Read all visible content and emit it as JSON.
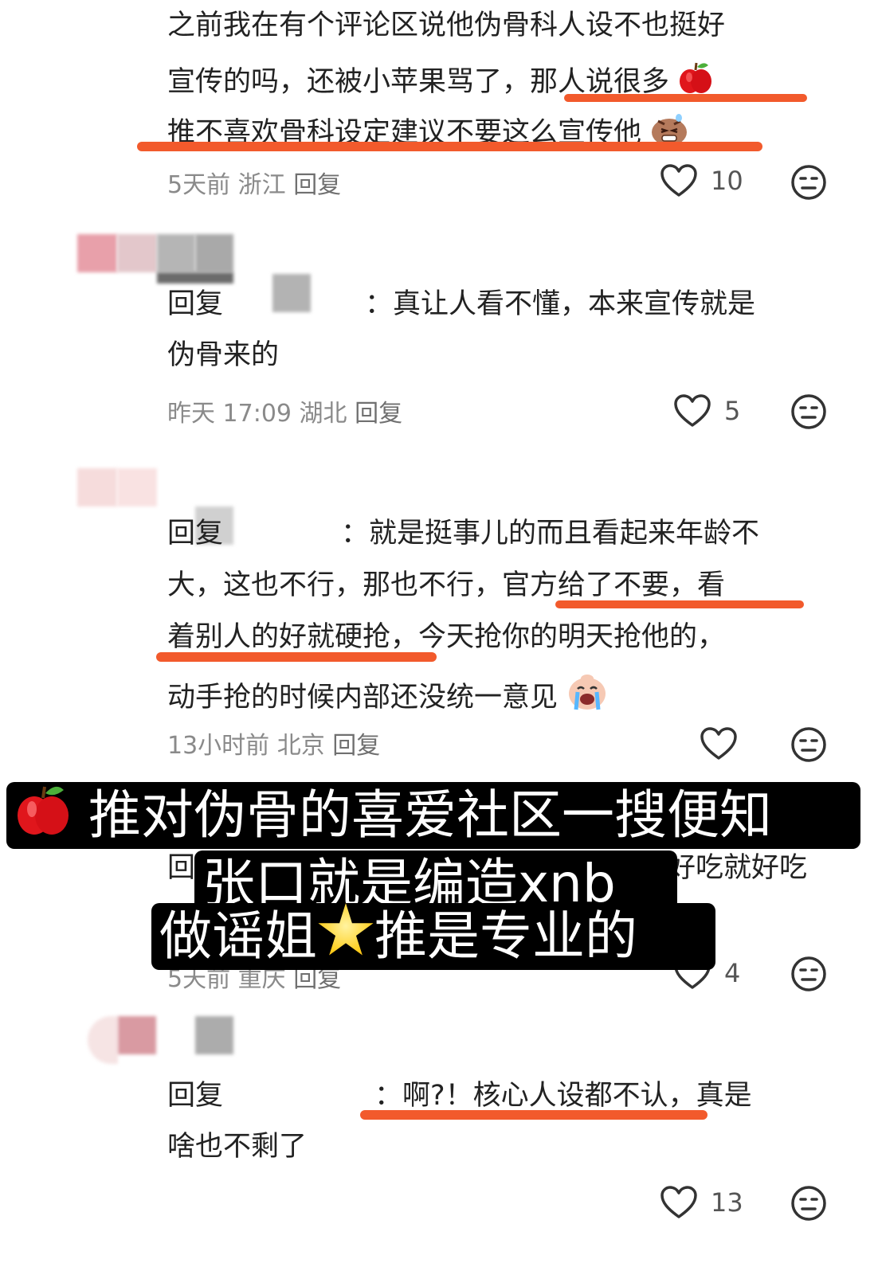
{
  "comments": [
    {
      "lines": [
        "之前我在有个评论区说他伪骨科人设不也挺好",
        "宣传的吗，还被小苹果骂了，那人说很多",
        "推不喜欢骨科设定建议不要这么宣传他"
      ],
      "time": "5天前",
      "location": "浙江",
      "reply_label": "回复",
      "likes": "10"
    },
    {
      "lines": [
        "回复",
        "：真让人看不懂，本来宣传就是",
        "伪骨来的"
      ],
      "time": "昨天 17:09",
      "location": "湖北",
      "reply_label": "回复",
      "likes": "5"
    },
    {
      "lines": [
        "回复",
        "：就是挺事儿的而且看起来年龄不",
        "大，这也不行，那也不行，官方给了不要，看",
        "着别人的好就硬抢，今天抢你的明天抢他的，",
        "动手抢的时候内部还没统一意见"
      ],
      "time": "13小时前",
      "location": "北京",
      "reply_label": "回复",
      "likes": ""
    },
    {
      "lines": [
        "回",
        "好吃就好吃"
      ],
      "time": "5天前",
      "location": "重庆",
      "reply_label": "回复",
      "likes": "4"
    },
    {
      "lines": [
        "回复",
        "：啊?！核心人设都不认，真是",
        "啥也不剩了"
      ],
      "likes": "13"
    }
  ],
  "banner": {
    "line1": "推对伪骨的喜爱社区一搜便知",
    "line2": "张口就是编造xnb",
    "line3a": "做谣姐",
    "line3b": "推是专业的"
  },
  "colors": {
    "highlight": "#f25a2c",
    "banner_bg": "#000000",
    "banner_text": "#ffffff"
  },
  "icons": [
    "heart-icon",
    "dislike-face-icon",
    "apple-emoji",
    "grimace-face-emoji",
    "crying-face-emoji",
    "star-emoji"
  ]
}
